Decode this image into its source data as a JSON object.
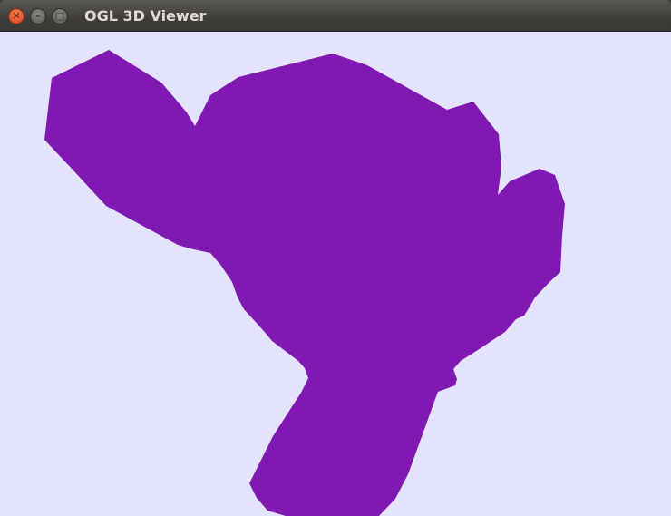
{
  "window": {
    "title": "OGL 3D Viewer",
    "close_glyph": "✕",
    "minimize_glyph": "–",
    "maximize_glyph": "□"
  },
  "viewport": {
    "background_color": "#e4e3fd",
    "model_color": "#7f19b2",
    "model_name": "monkey-head-model"
  }
}
